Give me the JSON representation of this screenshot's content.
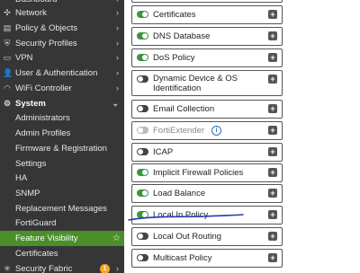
{
  "sidebar": {
    "items": [
      {
        "label": "Dashboard",
        "icon": "dashboard-icon",
        "glyph": "◔",
        "chevron": "›"
      },
      {
        "label": "Network",
        "icon": "network-icon",
        "glyph": "✣",
        "chevron": "›"
      },
      {
        "label": "Policy & Objects",
        "icon": "policy-icon",
        "glyph": "▤",
        "chevron": "›"
      },
      {
        "label": "Security Profiles",
        "icon": "shield-icon",
        "glyph": "⛨",
        "chevron": "›"
      },
      {
        "label": "VPN",
        "icon": "vpn-icon",
        "glyph": "▭",
        "chevron": "›"
      },
      {
        "label": "User & Authentication",
        "icon": "user-icon",
        "glyph": "👤",
        "chevron": "›"
      },
      {
        "label": "WiFi Controller",
        "icon": "wifi-icon",
        "glyph": "◠",
        "chevron": "›"
      },
      {
        "label": "System",
        "icon": "gear-icon",
        "glyph": "⚙",
        "chevron": "⌄"
      }
    ],
    "system_subitems": [
      "Administrators",
      "Admin Profiles",
      "Firmware & Registration",
      "Settings",
      "HA",
      "SNMP",
      "Replacement Messages",
      "FortiGuard",
      "Feature Visibility",
      "Certificates"
    ],
    "active_item": "Feature Visibility",
    "security_fabric": {
      "label": "Security Fabric",
      "badge": "1",
      "chevron": "›"
    }
  },
  "features": [
    {
      "label": "Certificates",
      "state": "on"
    },
    {
      "label": "DNS Database",
      "state": "on"
    },
    {
      "label": "DoS Policy",
      "state": "on"
    },
    {
      "label": "Dynamic Device & OS Identification",
      "state": "off"
    },
    {
      "label": "Email Collection",
      "state": "off"
    },
    {
      "label": "FortiExtender",
      "state": "disabled",
      "info": "i"
    },
    {
      "label": "ICAP",
      "state": "off"
    },
    {
      "label": "Implicit Firewall Policies",
      "state": "on"
    },
    {
      "label": "Load Balance",
      "state": "on"
    },
    {
      "label": "Local In Policy",
      "state": "on"
    },
    {
      "label": "Local Out Routing",
      "state": "off"
    },
    {
      "label": "Multicast Policy",
      "state": "off"
    }
  ],
  "colors": {
    "sidebar_bg": "#363636",
    "active_bg": "#4a8f2a",
    "toggle_on": "#3f9440",
    "annotation": "#1a3cb8"
  }
}
